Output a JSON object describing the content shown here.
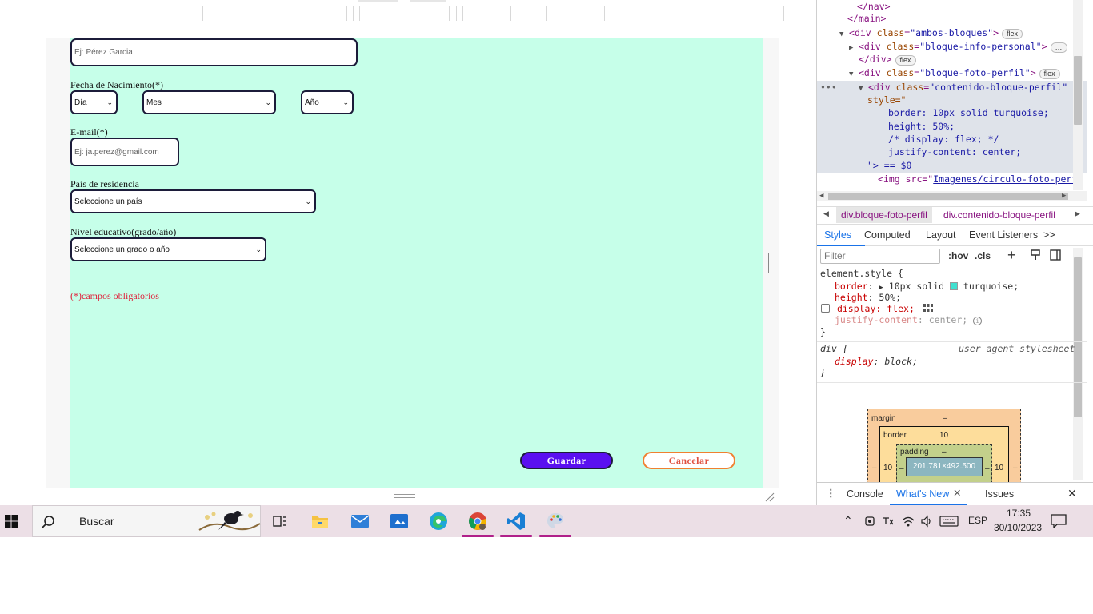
{
  "form": {
    "name_placeholder": "Ej: Pérez Garcia",
    "dob_label": "Fecha de Nacimiento(*)",
    "day_value": "Día",
    "month_value": "Mes",
    "year_value": "Año",
    "email_label": "E-mail(*)",
    "email_placeholder": "Ej: ja.perez@gmail.com",
    "country_label": "País de residencia",
    "country_value": "Seleccione un país",
    "education_label": "Nivel educativo(grado/año)",
    "education_value": "Seleccione un grado o año",
    "required_note": "(*)campos obligatorios",
    "save_label": "Guardar",
    "cancel_label": "Cancelar"
  },
  "devtools": {
    "dom": {
      "l0": "</nav>",
      "l1_close_main": "</main>",
      "l2_tag": "div",
      "l2_class": "ambos-bloques",
      "l2_badge": "flex",
      "l3_class": "bloque-info-personal",
      "l3_ellipsis": "…",
      "l4_close": "</div>",
      "l4_badge": "flex",
      "l5_class": "bloque-foto-perfil",
      "l5_badge": "flex",
      "l6_class": "contenido-bloque-perfil",
      "l6_style_attr": "style=\"",
      "css1": "border: 10px solid turquoise;",
      "css2": "height: 50%;",
      "css3": "/* display: flex; */",
      "css4": "justify-content: center;",
      "l7_end": "\"> == $0",
      "l8_img": "<img src=\"",
      "l8_src": "Imagenes/circulo-foto-perf"
    },
    "breadcrumbs": [
      "div.bloque-foto-perfil",
      "div.contenido-bloque-perfil"
    ],
    "tabs": [
      "Styles",
      "Computed",
      "Layout",
      "Event Listeners"
    ],
    "tabs_more": ">>",
    "filter_placeholder": "Filter",
    "hov": ":hov",
    "cls": ".cls",
    "styles": {
      "element_selector": "element.style {",
      "border_prop": "border",
      "border_value": "10px solid",
      "border_color_name": "turquoise;",
      "height_prop": "height",
      "height_value": "50%;",
      "display_disabled": "display: flex;",
      "justify_prop": "justify-content",
      "justify_value": "center;",
      "close_brace": "}",
      "div_selector": "div {",
      "ua_label": "user agent stylesheet",
      "display_prop": "display",
      "display_value": "block;"
    },
    "box_model": {
      "margin_label": "margin",
      "margin_value": "–",
      "border_label": "border",
      "border_value": "10",
      "padding_label": "padding",
      "padding_value": "–",
      "content_size": "201.781×492.500",
      "side_left": "10",
      "side_right": "10",
      "dash": "–"
    },
    "drawer": {
      "console": "Console",
      "whats_new": "What's New",
      "issues": "Issues"
    },
    "colors": {
      "turquoise": "#40e0d0",
      "tag": "#881280",
      "attr_name": "#994500",
      "attr_value": "#1a1aa6"
    }
  },
  "taskbar": {
    "search_text": "Buscar",
    "language": "ESP",
    "time": "17:35",
    "date": "30/10/2023",
    "icons": [
      "windows-start",
      "search",
      "task-view",
      "file-explorer",
      "mail",
      "photos",
      "edge",
      "chrome",
      "vscode",
      "paint"
    ]
  },
  "colors": {
    "form_background": "#c6ffe9",
    "save_button": "#5a10f0",
    "cancel_border": "#f08030",
    "required_note": "#e0203a"
  }
}
